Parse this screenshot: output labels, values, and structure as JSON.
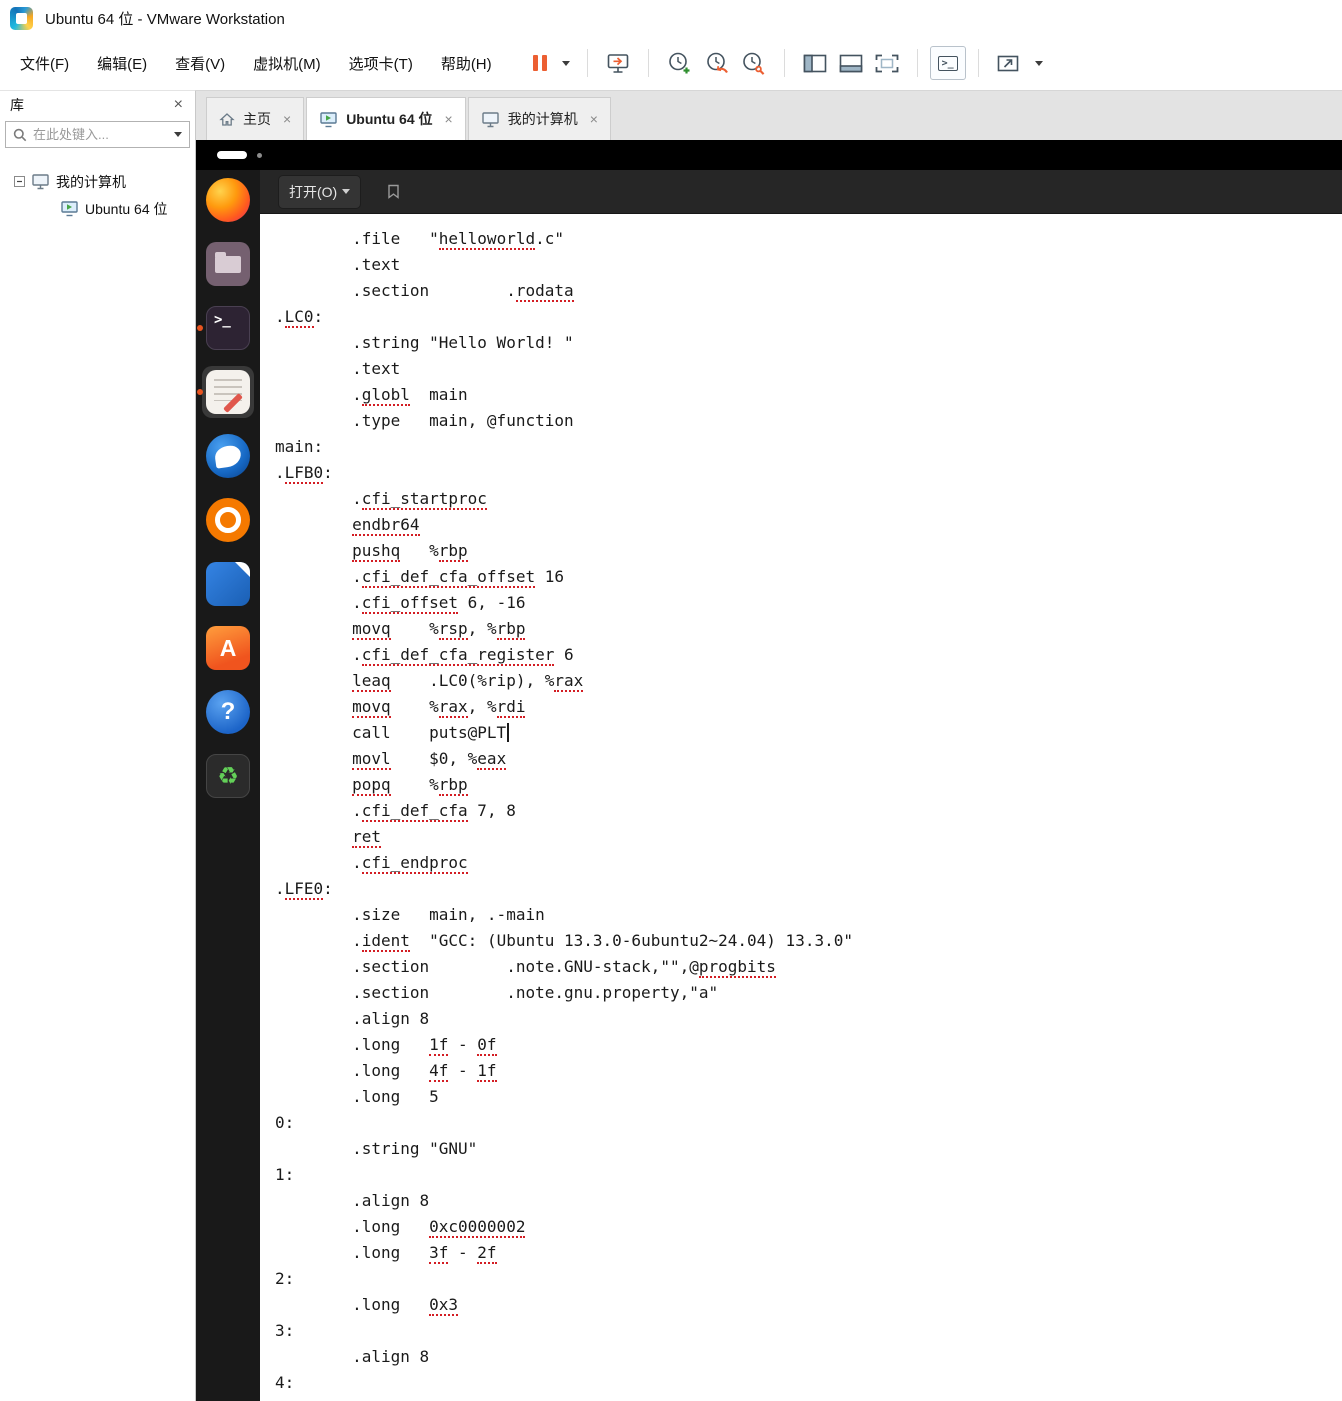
{
  "window": {
    "title": "Ubuntu 64 位 - VMware Workstation"
  },
  "menubar": {
    "items": [
      "文件(F)",
      "编辑(E)",
      "查看(V)",
      "虚拟机(M)",
      "选项卡(T)",
      "帮助(H)"
    ]
  },
  "toolbar": {
    "icons": [
      "pause-icon",
      "pause-dropdown-icon",
      "send-ctrl-alt-del-icon",
      "take-snapshot-icon",
      "revert-snapshot-icon",
      "snapshot-manager-icon",
      "show-library-icon",
      "show-thumbnail-bar-icon",
      "fit-guest-icon",
      "console-view-icon",
      "fullscreen-icon",
      "fullscreen-dropdown-icon"
    ]
  },
  "tabbar": {
    "close_glyph": "×",
    "tabs": [
      {
        "label": "主页",
        "icon": "home-icon",
        "active": false
      },
      {
        "label": "Ubuntu 64 位",
        "icon": "vm-icon",
        "active": true
      },
      {
        "label": "我的计算机",
        "icon": "computer-icon",
        "active": false
      }
    ]
  },
  "library": {
    "title": "库",
    "close_glyph": "×",
    "search_placeholder": "在此处键入...",
    "tree": [
      {
        "label": "我的计算机",
        "level": 0,
        "icon": "computer-icon"
      },
      {
        "label": "Ubuntu 64 位",
        "level": 1,
        "icon": "vm-powered-icon"
      }
    ]
  },
  "vm": {
    "dock_items": [
      "firefox-icon",
      "files-icon",
      "terminal-icon",
      "text-editor-icon",
      "thunderbird-icon",
      "rhythmbox-icon",
      "libreoffice-writer-icon",
      "app-center-icon",
      "help-icon",
      "trash-icon"
    ],
    "running_items": [
      "terminal-icon",
      "text-editor-icon"
    ],
    "active_item": "text-editor-icon"
  },
  "gedit": {
    "open_button": "打开(O)",
    "lines": [
      {
        "s": [
          [
            "        .file   \"",
            0
          ],
          [
            "helloworld",
            1
          ],
          [
            ".c\"",
            0
          ]
        ]
      },
      {
        "s": [
          [
            "        .text",
            0
          ]
        ]
      },
      {
        "s": [
          [
            "        .section        .",
            0
          ],
          [
            "rodata",
            1
          ]
        ]
      },
      {
        "s": [
          [
            ".",
            0
          ],
          [
            "LC0",
            1
          ],
          [
            ":",
            0
          ]
        ]
      },
      {
        "s": [
          [
            "        .string \"Hello World! \"",
            0
          ]
        ]
      },
      {
        "s": [
          [
            "        .text",
            0
          ]
        ]
      },
      {
        "s": [
          [
            "        .",
            0
          ],
          [
            "globl",
            1
          ],
          [
            "  main",
            0
          ]
        ]
      },
      {
        "s": [
          [
            "        .type   main, @function",
            0
          ]
        ]
      },
      {
        "s": [
          [
            "main:",
            0
          ]
        ]
      },
      {
        "s": [
          [
            ".",
            0
          ],
          [
            "LFB0",
            1
          ],
          [
            ":",
            0
          ]
        ]
      },
      {
        "s": [
          [
            "        .",
            0
          ],
          [
            "cfi_startproc",
            1
          ]
        ]
      },
      {
        "s": [
          [
            "        ",
            0
          ],
          [
            "endbr64",
            1
          ]
        ]
      },
      {
        "s": [
          [
            "        ",
            0
          ],
          [
            "pushq",
            1
          ],
          [
            "   %",
            0
          ],
          [
            "rbp",
            1
          ]
        ]
      },
      {
        "s": [
          [
            "        .",
            0
          ],
          [
            "cfi_def_cfa_offset",
            1
          ],
          [
            " 16",
            0
          ]
        ]
      },
      {
        "s": [
          [
            "        .",
            0
          ],
          [
            "cfi_offset",
            1
          ],
          [
            " 6, -16",
            0
          ]
        ]
      },
      {
        "s": [
          [
            "        ",
            0
          ],
          [
            "movq",
            1
          ],
          [
            "    %",
            0
          ],
          [
            "rsp",
            1
          ],
          [
            ", %",
            0
          ],
          [
            "rbp",
            1
          ]
        ]
      },
      {
        "s": [
          [
            "        .",
            0
          ],
          [
            "cfi_def_cfa_register",
            1
          ],
          [
            " 6",
            0
          ]
        ]
      },
      {
        "s": [
          [
            "        ",
            0
          ],
          [
            "leaq",
            1
          ],
          [
            "    .LC0(%rip), %",
            0
          ],
          [
            "rax",
            1
          ]
        ]
      },
      {
        "s": [
          [
            "        ",
            0
          ],
          [
            "movq",
            1
          ],
          [
            "    %",
            0
          ],
          [
            "rax",
            1
          ],
          [
            ", %",
            0
          ],
          [
            "rdi",
            1
          ]
        ]
      },
      {
        "s": [
          [
            "        call    puts@PLT",
            0
          ]
        ],
        "caret": true
      },
      {
        "s": [
          [
            "        ",
            0
          ],
          [
            "movl",
            1
          ],
          [
            "    $0, %",
            0
          ],
          [
            "eax",
            1
          ]
        ]
      },
      {
        "s": [
          [
            "        ",
            0
          ],
          [
            "popq",
            1
          ],
          [
            "    %",
            0
          ],
          [
            "rbp",
            1
          ]
        ]
      },
      {
        "s": [
          [
            "        .",
            0
          ],
          [
            "cfi_def_cfa",
            1
          ],
          [
            " 7, 8",
            0
          ]
        ]
      },
      {
        "s": [
          [
            "        ",
            0
          ],
          [
            "ret",
            1
          ]
        ]
      },
      {
        "s": [
          [
            "        .",
            0
          ],
          [
            "cfi_endproc",
            1
          ]
        ]
      },
      {
        "s": [
          [
            ".",
            0
          ],
          [
            "LFE0",
            1
          ],
          [
            ":",
            0
          ]
        ]
      },
      {
        "s": [
          [
            "        .size   main, .-main",
            0
          ]
        ]
      },
      {
        "s": [
          [
            "        .",
            0
          ],
          [
            "ident",
            1
          ],
          [
            "  \"GCC: (Ubuntu 13.3.0-6ubuntu2~24.04) 13.3.0\"",
            0
          ]
        ]
      },
      {
        "s": [
          [
            "        .section        .note.GNU-stack,\"\",@",
            0
          ],
          [
            "progbits",
            1
          ]
        ]
      },
      {
        "s": [
          [
            "        .section        .note.gnu.property,\"a\"",
            0
          ]
        ]
      },
      {
        "s": [
          [
            "        .align 8",
            0
          ]
        ]
      },
      {
        "s": [
          [
            "        .long   ",
            0
          ],
          [
            "1f",
            1
          ],
          [
            " - ",
            0
          ],
          [
            "0f",
            1
          ]
        ]
      },
      {
        "s": [
          [
            "        .long   ",
            0
          ],
          [
            "4f",
            1
          ],
          [
            " - ",
            0
          ],
          [
            "1f",
            1
          ]
        ]
      },
      {
        "s": [
          [
            "        .long   5",
            0
          ]
        ]
      },
      {
        "s": [
          [
            "0:",
            0
          ]
        ]
      },
      {
        "s": [
          [
            "        .string \"GNU\"",
            0
          ]
        ]
      },
      {
        "s": [
          [
            "1:",
            0
          ]
        ]
      },
      {
        "s": [
          [
            "        .align 8",
            0
          ]
        ]
      },
      {
        "s": [
          [
            "        .long   ",
            0
          ],
          [
            "0xc0000002",
            1
          ]
        ]
      },
      {
        "s": [
          [
            "        .long   ",
            0
          ],
          [
            "3f",
            1
          ],
          [
            " - ",
            0
          ],
          [
            "2f",
            1
          ]
        ]
      },
      {
        "s": [
          [
            "2:",
            0
          ]
        ]
      },
      {
        "s": [
          [
            "        .long   ",
            0
          ],
          [
            "0x3",
            1
          ]
        ]
      },
      {
        "s": [
          [
            "3:",
            0
          ]
        ]
      },
      {
        "s": [
          [
            "        .align 8",
            0
          ]
        ]
      },
      {
        "s": [
          [
            "4:",
            0
          ]
        ]
      }
    ]
  },
  "colors": {
    "accent_orange": "#ec5f32",
    "spellcheck_red": "#d31d23",
    "ubuntu_orange": "#e95420"
  }
}
